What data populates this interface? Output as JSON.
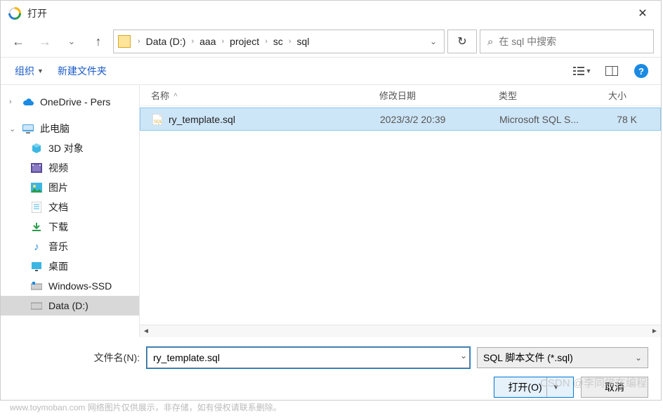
{
  "titlebar": {
    "title": "打开"
  },
  "breadcrumb": {
    "segments": [
      "Data (D:)",
      "aaa",
      "project",
      "sc",
      "sql"
    ]
  },
  "search": {
    "placeholder": "在 sql 中搜索"
  },
  "toolbar": {
    "organize": "组织",
    "new_folder": "新建文件夹"
  },
  "tree": {
    "onedrive": "OneDrive - Pers",
    "this_pc": "此电脑",
    "items": [
      {
        "label": "3D 对象"
      },
      {
        "label": "视频"
      },
      {
        "label": "图片"
      },
      {
        "label": "文档"
      },
      {
        "label": "下载"
      },
      {
        "label": "音乐"
      },
      {
        "label": "桌面"
      },
      {
        "label": "Windows-SSD"
      },
      {
        "label": "Data (D:)"
      }
    ]
  },
  "columns": {
    "name": "名称",
    "date": "修改日期",
    "type": "类型",
    "size": "大小"
  },
  "files": [
    {
      "name": "ry_template.sql",
      "date": "2023/3/2 20:39",
      "type": "Microsoft SQL S...",
      "size": "78 K"
    }
  ],
  "footer": {
    "filename_label": "文件名(N):",
    "filename_value": "ry_template.sql",
    "filter_value": "SQL 脚本文件 (*.sql)",
    "open_btn": "打开(O)",
    "cancel_btn": "取消"
  },
  "disclaimer": "www.toymoban.com  网络图片仅供展示，非存储，如有侵权请联系删除。",
  "watermark": "CSDN @李同学在编程"
}
